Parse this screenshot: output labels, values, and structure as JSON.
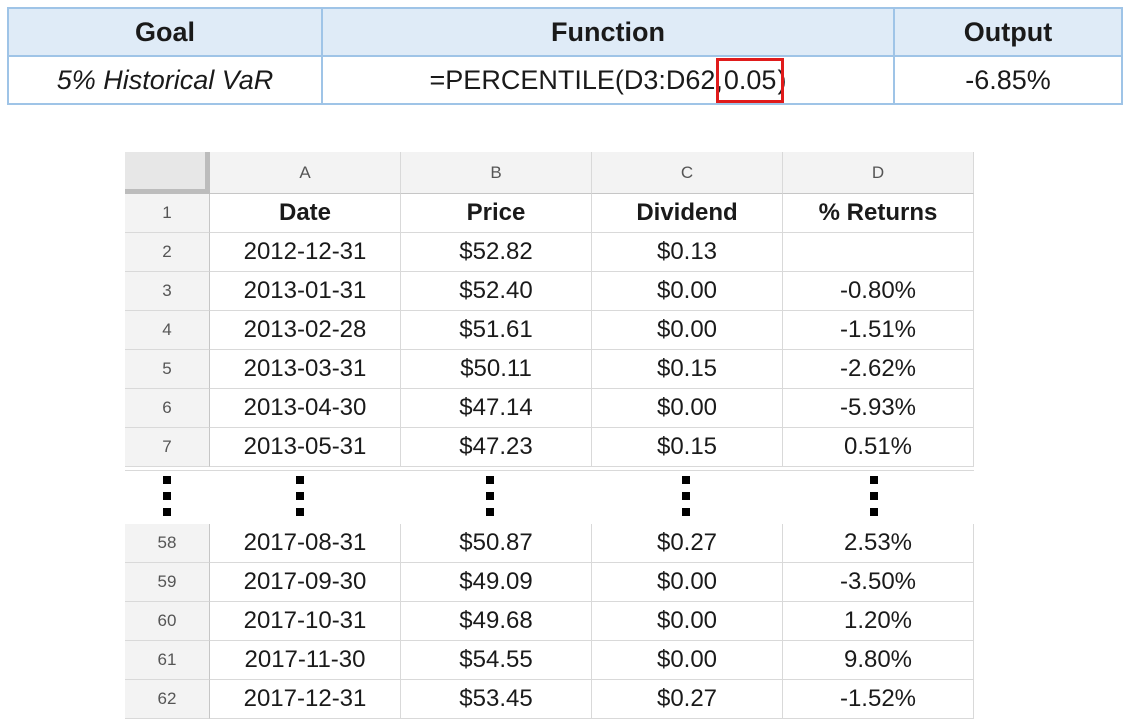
{
  "summary": {
    "headers": [
      "Goal",
      "Function",
      "Output"
    ],
    "goal": "5% Historical VaR",
    "formula_prefix": "=PERCENTILE(D3:D62,",
    "formula_highlight": "0.05",
    "formula_suffix": ")",
    "output": "-6.85%",
    "highlight_color": "#e01b1b"
  },
  "sheet": {
    "columns": [
      "A",
      "B",
      "C",
      "D"
    ],
    "header_row": {
      "n": "1",
      "cells": [
        "Date",
        "Price",
        "Dividend",
        "% Returns"
      ]
    },
    "rows_top": [
      {
        "n": "2",
        "cells": [
          "2012-12-31",
          "$52.82",
          "$0.13",
          ""
        ]
      },
      {
        "n": "3",
        "cells": [
          "2013-01-31",
          "$52.40",
          "$0.00",
          "-0.80%"
        ]
      },
      {
        "n": "4",
        "cells": [
          "2013-02-28",
          "$51.61",
          "$0.00",
          "-1.51%"
        ]
      },
      {
        "n": "5",
        "cells": [
          "2013-03-31",
          "$50.11",
          "$0.15",
          "-2.62%"
        ]
      },
      {
        "n": "6",
        "cells": [
          "2013-04-30",
          "$47.14",
          "$0.00",
          "-5.93%"
        ]
      },
      {
        "n": "7",
        "cells": [
          "2013-05-31",
          "$47.23",
          "$0.15",
          "0.51%"
        ]
      }
    ],
    "rows_bottom": [
      {
        "n": "58",
        "cells": [
          "2017-08-31",
          "$50.87",
          "$0.27",
          "2.53%"
        ]
      },
      {
        "n": "59",
        "cells": [
          "2017-09-30",
          "$49.09",
          "$0.00",
          "-3.50%"
        ]
      },
      {
        "n": "60",
        "cells": [
          "2017-10-31",
          "$49.68",
          "$0.00",
          "1.20%"
        ]
      },
      {
        "n": "61",
        "cells": [
          "2017-11-30",
          "$54.55",
          "$0.00",
          "9.80%"
        ]
      },
      {
        "n": "62",
        "cells": [
          "2017-12-31",
          "$53.45",
          "$0.27",
          "-1.52%"
        ]
      }
    ]
  }
}
